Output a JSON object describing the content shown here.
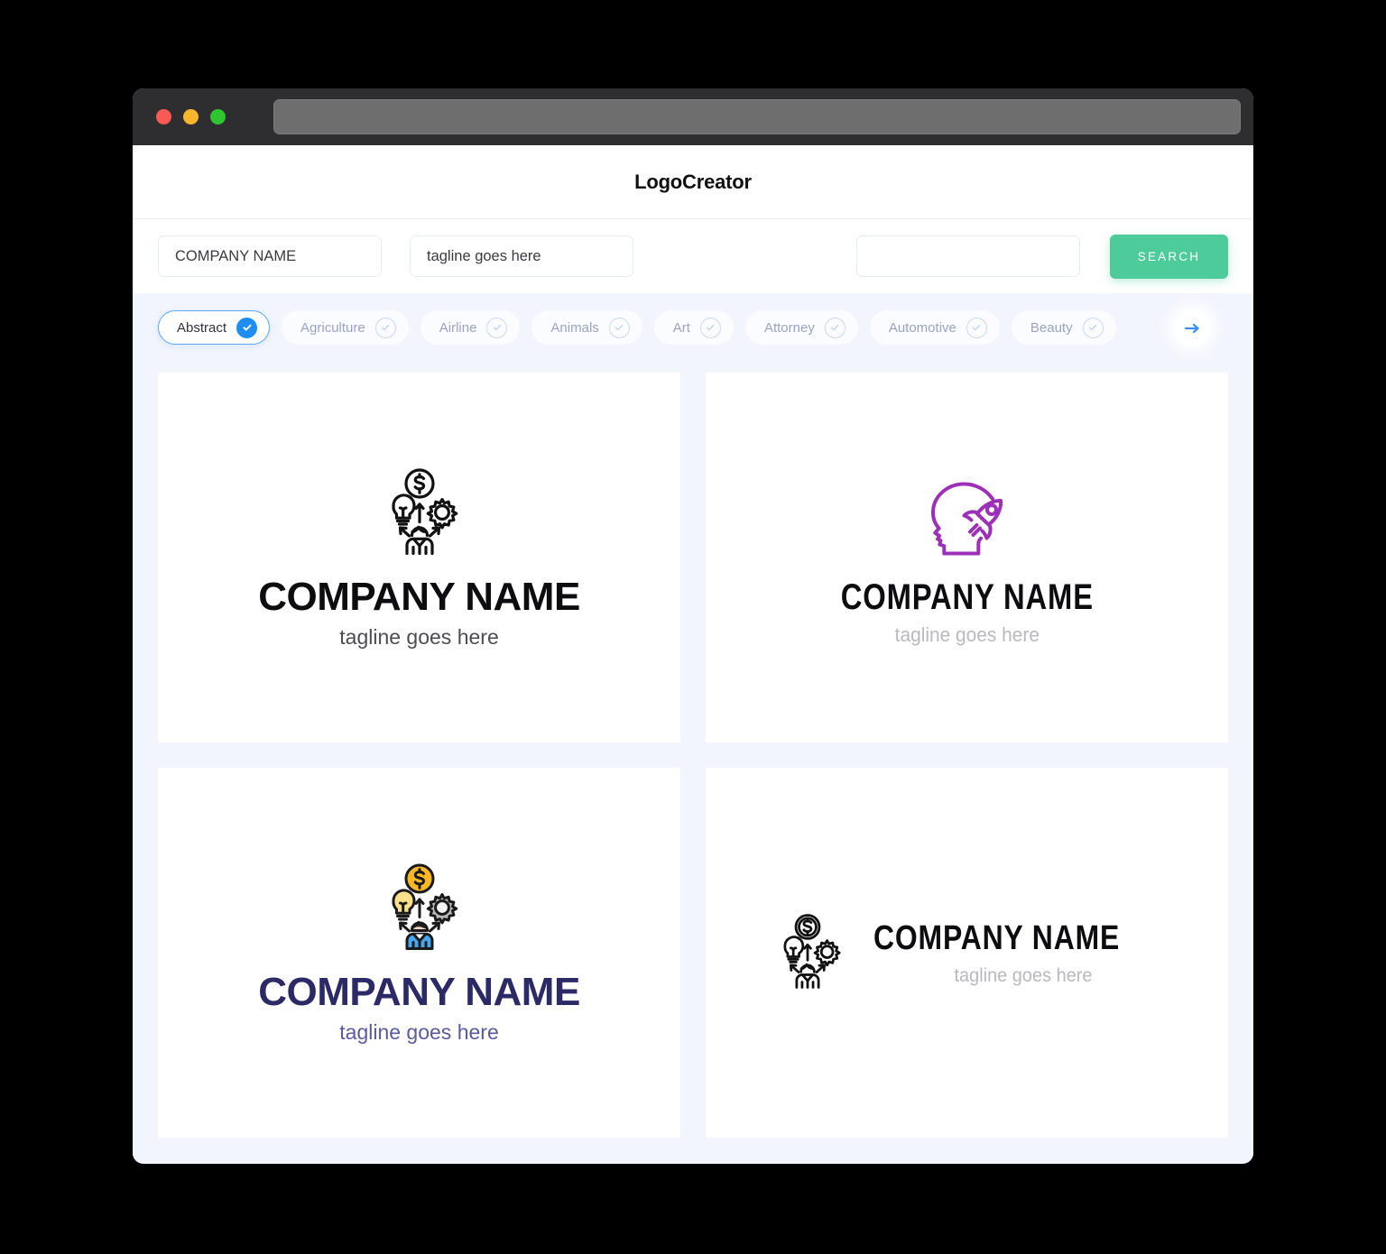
{
  "window": {
    "traffic_lights": [
      "close",
      "minimize",
      "maximize"
    ],
    "address_bar_value": "",
    "colors": {
      "titlebar": "#2e2e30",
      "address_bar": "#6e6e6e",
      "close": "#fb5a52",
      "minimize": "#f9b52b",
      "maximize": "#2fc52f",
      "page_background": "#f2f5fd",
      "accent_green": "#4ecb9a",
      "accent_blue": "#1f8ef1"
    }
  },
  "header": {
    "title": "LogoCreator"
  },
  "search": {
    "company_value": "COMPANY NAME",
    "company_placeholder": "COMPANY NAME",
    "tagline_value": "tagline goes here",
    "tagline_placeholder": "tagline goes here",
    "keyword_value": "",
    "keyword_placeholder": "",
    "button_label": "SEARCH"
  },
  "categories": {
    "items": [
      {
        "label": "Abstract",
        "selected": true
      },
      {
        "label": "Agriculture",
        "selected": false
      },
      {
        "label": "Airline",
        "selected": false
      },
      {
        "label": "Animals",
        "selected": false
      },
      {
        "label": "Art",
        "selected": false
      },
      {
        "label": "Attorney",
        "selected": false
      },
      {
        "label": "Automotive",
        "selected": false
      },
      {
        "label": "Beauty",
        "selected": false
      }
    ],
    "next_arrow": "arrow-right-icon"
  },
  "logos": [
    {
      "name": "COMPANY NAME",
      "tagline": "tagline goes here",
      "icon": "idea-money-gear-person-icon",
      "icon_color": "#111111",
      "title_color": "#0d0d0f",
      "tagline_color": "#4c4c55",
      "layout": "stacked"
    },
    {
      "name": "COMPANY NAME",
      "tagline": "tagline goes here",
      "icon": "head-rocket-icon",
      "icon_color": "#9c31b8",
      "title_color": "#0d0d0f",
      "tagline_color": "#b9b9bf",
      "layout": "stacked"
    },
    {
      "name": "COMPANY NAME",
      "tagline": "tagline goes here",
      "icon": "idea-money-gear-person-color-icon",
      "icon_color": "#f4b731",
      "title_color": "#2b2a66",
      "tagline_color": "#5a5a9c",
      "layout": "stacked"
    },
    {
      "name": "COMPANY NAME",
      "tagline": "tagline goes here",
      "icon": "idea-money-gear-person-icon",
      "icon_color": "#111111",
      "title_color": "#0d0d0f",
      "tagline_color": "#b9b9bf",
      "layout": "horizontal"
    }
  ]
}
